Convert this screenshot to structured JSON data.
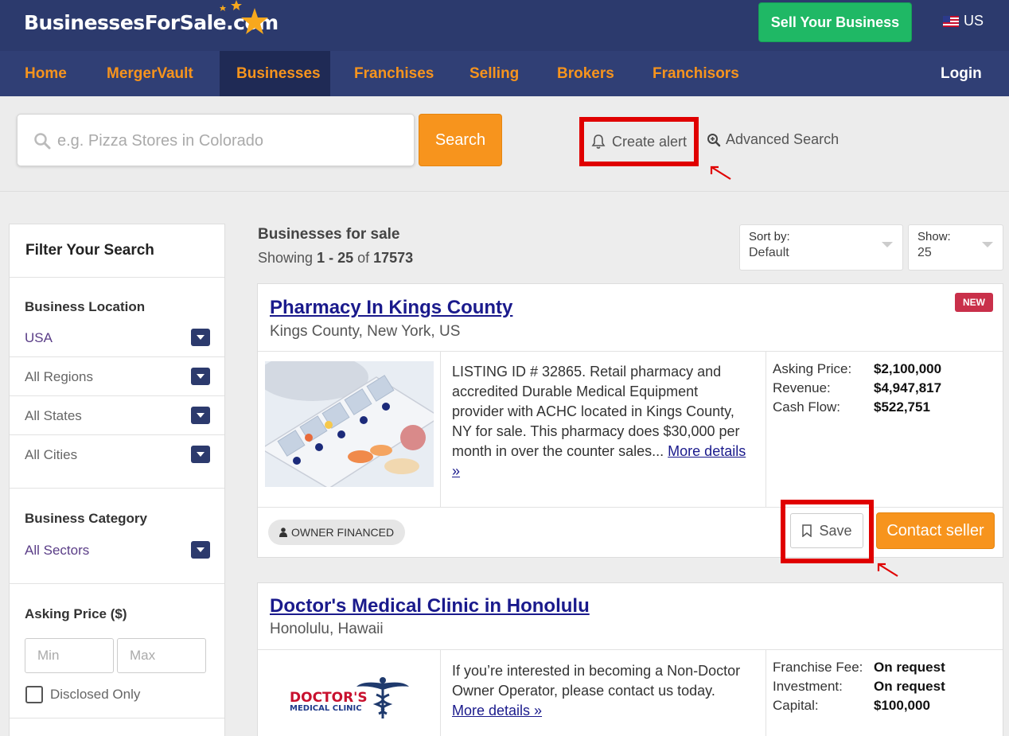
{
  "header": {
    "logo_text": "BusinessesForSale.com",
    "sell_button": "Sell Your Business",
    "locale": "US"
  },
  "nav": {
    "items": [
      "Home",
      "MergerVault",
      "Businesses",
      "Franchises",
      "Selling",
      "Brokers",
      "Franchisors"
    ],
    "active": "Businesses",
    "login": "Login"
  },
  "search": {
    "placeholder": "e.g. Pizza Stores in Colorado",
    "button": "Search",
    "create_alert": "Create alert",
    "advanced": "Advanced Search"
  },
  "sidebar": {
    "title": "Filter Your Search",
    "location_heading": "Business Location",
    "location_rows": [
      "USA",
      "All Regions",
      "All States",
      "All Cities"
    ],
    "category_heading": "Business Category",
    "category_value": "All Sectors",
    "price_heading": "Asking Price ($)",
    "min_placeholder": "Min",
    "max_placeholder": "Max",
    "disclosed_label": "Disclosed Only"
  },
  "results": {
    "title": "Businesses for sale",
    "showing_prefix": "Showing ",
    "range": "1 - 25",
    "of": " of ",
    "total": "17573",
    "sort_label": "Sort by:",
    "sort_value": "Default",
    "show_label": "Show:",
    "show_value": "25"
  },
  "listings": [
    {
      "title": "Pharmacy In Kings County",
      "location": "Kings County, New York, US",
      "badge": "NEW",
      "description": "LISTING ID # 32865. Retail pharmacy and accredited Durable Medical Equipment provider with ACHC located in Kings County, NY for sale. This pharmacy does $30,000 per month in over the counter sales...",
      "more": "More details »",
      "financials": [
        {
          "label": "Asking Price:",
          "value": "$2,100,000"
        },
        {
          "label": "Revenue:",
          "value": "$4,947,817"
        },
        {
          "label": "Cash Flow:",
          "value": "$522,751"
        }
      ],
      "tag": "OWNER FINANCED",
      "save": "Save",
      "contact": "Contact seller"
    },
    {
      "title": "Doctor's Medical Clinic in Honolulu",
      "location": "Honolulu, Hawaii",
      "description": "If you’re interested in becoming a Non-Doctor Owner Operator, please contact us today.",
      "more": "More details »",
      "logo_line1": "DOCTOR'S",
      "logo_line2": "MEDICAL CLINIC",
      "financials": [
        {
          "label": "Franchise Fee:",
          "value": "On request"
        },
        {
          "label": "Investment:",
          "value": "On request"
        },
        {
          "label": "Capital:",
          "value": "$100,000"
        }
      ]
    }
  ],
  "colors": {
    "header_bg": "#2c3a6d",
    "nav_orange": "#f7941d",
    "sell_green": "#1fb865",
    "annotation_red": "#e00000",
    "link_blue": "#1a1a8c",
    "new_badge": "#c9304a"
  }
}
